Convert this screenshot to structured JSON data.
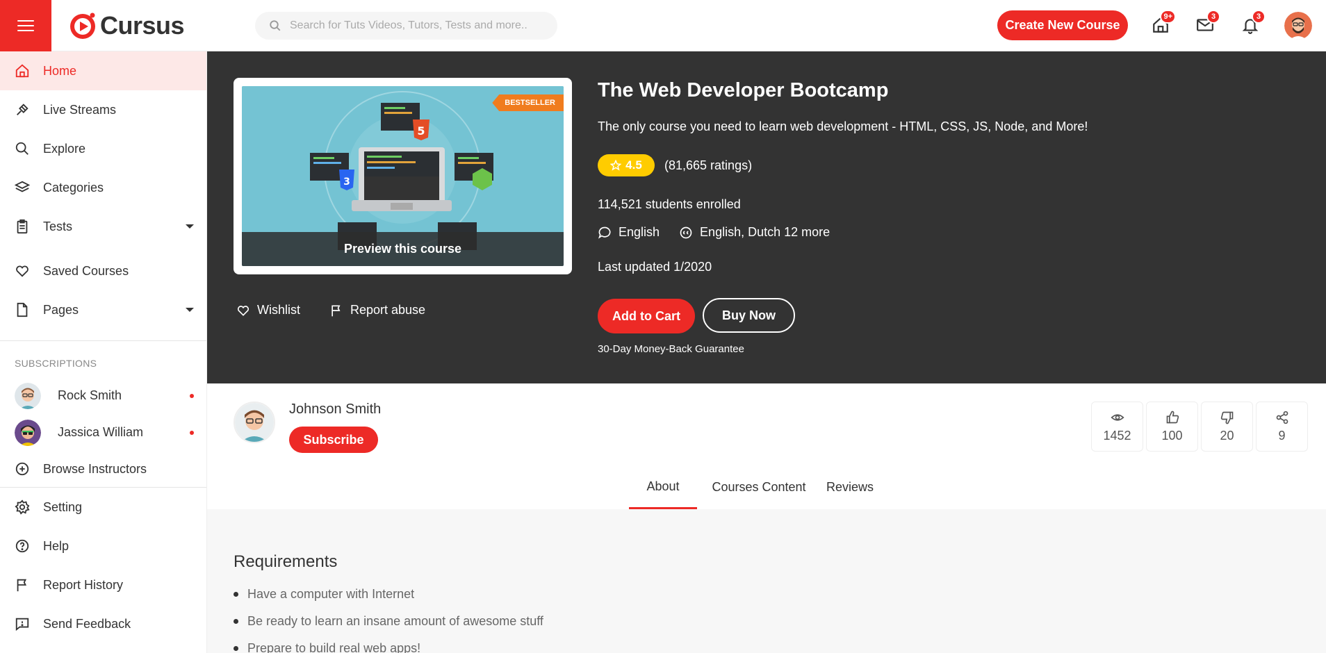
{
  "colors": {
    "accent": "#ed2a26",
    "hero_bg": "#333333",
    "rating": "#ffcc00",
    "bestseller": "#f07c1e"
  },
  "header": {
    "brand": "Cursus",
    "search_placeholder": "Search for Tuts Videos, Tutors, Tests and more..",
    "create_label": "Create New Course",
    "icons": [
      {
        "name": "home-icon",
        "badge": "9+"
      },
      {
        "name": "mail-icon",
        "badge": "3"
      },
      {
        "name": "bell-icon",
        "badge": "3"
      }
    ]
  },
  "sidebar": {
    "items": [
      {
        "label": "Home",
        "icon": "home-icon",
        "active": true
      },
      {
        "label": "Live Streams",
        "icon": "live-streams-icon"
      },
      {
        "label": "Explore",
        "icon": "search-icon"
      },
      {
        "label": "Categories",
        "icon": "layers-icon"
      },
      {
        "label": "Tests",
        "icon": "clipboard-icon",
        "expandable": true
      },
      {
        "label": "Saved Courses",
        "icon": "heart-icon"
      },
      {
        "label": "Pages",
        "icon": "file-icon",
        "expandable": true
      }
    ],
    "subscriptions_title": "SUBSCRIPTIONS",
    "subscriptions": [
      {
        "label": "Rock Smith"
      },
      {
        "label": "Jassica William"
      }
    ],
    "browse_label": "Browse Instructors",
    "bottom_items": [
      {
        "label": "Setting",
        "icon": "gear-icon"
      },
      {
        "label": "Help",
        "icon": "help-icon"
      },
      {
        "label": "Report History",
        "icon": "flag-icon"
      },
      {
        "label": "Send Feedback",
        "icon": "feedback-icon"
      }
    ]
  },
  "course": {
    "badge": "BESTSELLER",
    "preview_label": "Preview this course",
    "wishlist_label": "Wishlist",
    "report_label": "Report abuse",
    "title": "The Web Developer Bootcamp",
    "subtitle": "The only course you need to learn web development - HTML, CSS, JS, Node, and More!",
    "rating": "4.5",
    "ratings_count": "(81,665 ratings)",
    "enrolled": "114,521 students enrolled",
    "language": "English",
    "captions": "English, Dutch 12 more",
    "updated": "Last updated 1/2020",
    "cart_label": "Add to Cart",
    "buy_label": "Buy Now",
    "guarantee": "30-Day Money-Back Guarantee"
  },
  "instructor": {
    "name": "Johnson Smith",
    "subscribe_label": "Subscribe",
    "stats": [
      {
        "icon": "eye-icon",
        "value": "1452"
      },
      {
        "icon": "thumbs-up-icon",
        "value": "100"
      },
      {
        "icon": "thumbs-down-icon",
        "value": "20"
      },
      {
        "icon": "share-icon",
        "value": "9"
      }
    ]
  },
  "tabs": [
    {
      "label": "About",
      "active": true
    },
    {
      "label": "Courses Content"
    },
    {
      "label": "Reviews"
    }
  ],
  "requirements": {
    "title": "Requirements",
    "items": [
      "Have a computer with Internet",
      "Be ready to learn an insane amount of awesome stuff",
      "Prepare to build real web apps!"
    ]
  }
}
